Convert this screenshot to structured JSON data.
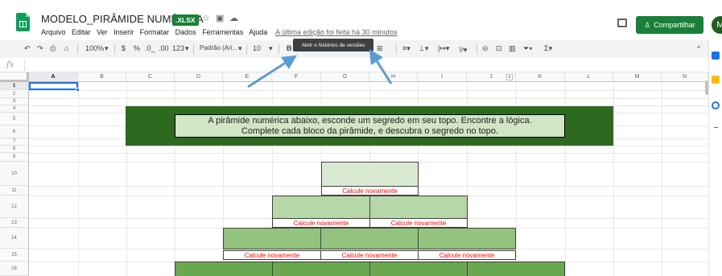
{
  "titlebar": {
    "doc_title": "MODELO_PIRÂMIDE NUMÉRICA",
    "badge": ".XLSX",
    "star_icon": "star-icon",
    "folder_icon": "folder-icon",
    "cloud_icon": "cloud-status-icon"
  },
  "menu": [
    "Arquivo",
    "Editar",
    "Ver",
    "Inserir",
    "Formatar",
    "Dados",
    "Ferramentas",
    "Ajuda"
  ],
  "last_edit": "A última edição foi feita há 30 minutos",
  "share_label": "Compartilhar",
  "avatar_initial": "M",
  "toolbar": {
    "zoom": "100%",
    "currency": "$",
    "percent": "%",
    "dec_decrease": ".0_",
    "dec_increase": ".00",
    "format_more": "123",
    "font": "Padrão (Ari...",
    "font_size": "10",
    "bold": "B",
    "tooltip": "Abrir o histórico de versões"
  },
  "formula_bar": {
    "fx": "fx",
    "value": ""
  },
  "columns": [
    "A",
    "B",
    "C",
    "D",
    "E",
    "F",
    "G",
    "H",
    "I",
    "J",
    "K",
    "L",
    "M",
    "N"
  ],
  "rows": [
    "1",
    "2",
    "3",
    "4",
    "5",
    "6",
    "7",
    "8",
    "9",
    "10",
    "11",
    "12",
    "13",
    "14",
    "15",
    "16"
  ],
  "selected_cell": "A1",
  "banner": {
    "line1": "A pirâmide numérica abaixo, esconde um segredo em seu topo. Encontre a lógica.",
    "line2": "Complete cada bloco da pirâmide, e descubra o segredo no topo."
  },
  "pyramid": {
    "message": "Calcule novamente",
    "row1_messages": [
      "Calcule novamente"
    ],
    "row2_messages": [
      "Calcule novamente",
      "Calcule novamente"
    ],
    "row3_messages": [
      "Calcule novamente",
      "Calcule novamente",
      "Calcule novamente"
    ]
  },
  "colors": {
    "sheets_green": "#0f9d58",
    "share_green": "#188038",
    "banner_dark": "#2d6a1f",
    "banner_light": "#d0e6c4",
    "error_red": "#ff0000",
    "selection_blue": "#1a73e8",
    "annotation_arrow": "#5b9bd5"
  }
}
